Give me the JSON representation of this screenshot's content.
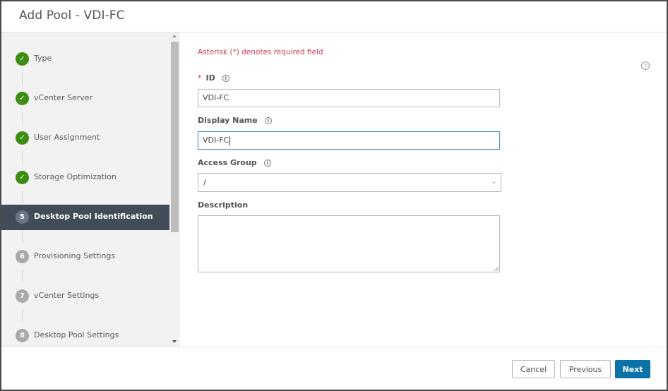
{
  "dialog": {
    "title": "Add Pool - VDI-FC"
  },
  "sidebar": {
    "steps": [
      {
        "number": "1",
        "label": "Type",
        "status": "done"
      },
      {
        "number": "2",
        "label": "vCenter Server",
        "status": "done"
      },
      {
        "number": "3",
        "label": "User Assignment",
        "status": "done"
      },
      {
        "number": "4",
        "label": "Storage Optimization",
        "status": "done"
      },
      {
        "number": "5",
        "label": "Desktop Pool Identification",
        "status": "active"
      },
      {
        "number": "6",
        "label": "Provisioning Settings",
        "status": "todo"
      },
      {
        "number": "7",
        "label": "vCenter Settings",
        "status": "todo"
      },
      {
        "number": "8",
        "label": "Desktop Pool Settings",
        "status": "todo"
      }
    ],
    "check_glyph": "✓"
  },
  "form": {
    "required_note": "Asterisk (*) denotes required field",
    "help_glyph": "?",
    "info_glyph": "i",
    "id": {
      "label": "ID",
      "required_mark": "*",
      "value": "VDI-FC"
    },
    "display_name": {
      "label": "Display Name",
      "value": "VDI-FC"
    },
    "access_group": {
      "label": "Access Group",
      "value": "/",
      "chevron": "⌄"
    },
    "description": {
      "label": "Description",
      "value": ""
    }
  },
  "footer": {
    "cancel_label": "Cancel",
    "previous_label": "Previous",
    "next_label": "Next"
  },
  "colors": {
    "accent": "#0b72a8",
    "done": "#3d8c14",
    "active_step_bg": "#414c58",
    "required": "#c9414f"
  }
}
